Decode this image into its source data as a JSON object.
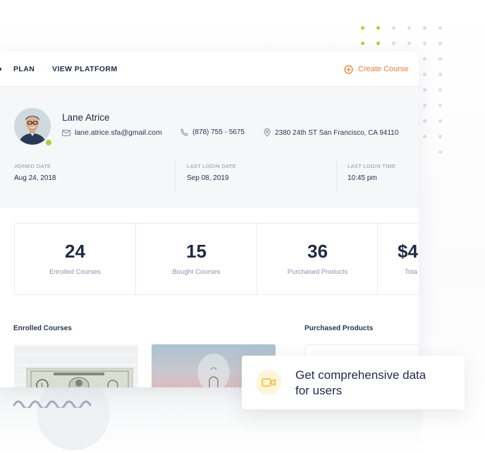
{
  "nav": {
    "tabs": [
      {
        "label": "PLAN"
      },
      {
        "label": "VIEW PLATFORM"
      }
    ],
    "create_label": "Create Course",
    "accent": "#f47b36"
  },
  "profile": {
    "name": "Lane Atrice",
    "email": "lane.atrice.sfa@gmail.com",
    "phone": "(878) 755 - 5675",
    "address": "2380 24th ST San Francisco, CA 94110",
    "meta": [
      {
        "label": "JOINED DATE",
        "value": "Aug 24, 2018"
      },
      {
        "label": "LAST LOGIN DATE",
        "value": "Sep 08, 2019"
      },
      {
        "label": "LAST LOGIN TIME",
        "value": "10:45 pm"
      }
    ]
  },
  "stats": [
    {
      "value": "24",
      "label": "Enrolled Courses"
    },
    {
      "value": "15",
      "label": "Bought Courses"
    },
    {
      "value": "36",
      "label": "Purchased Products"
    },
    {
      "value": "$4",
      "label": "Tota"
    }
  ],
  "sections": {
    "enrolled_title": "Enrolled Courses",
    "purchased_title": "Purchased Products"
  },
  "callout": {
    "line1": "Get comprehensive data",
    "line2": "for users",
    "icon": "video-camera-icon",
    "icon_color": "#f5b623"
  }
}
